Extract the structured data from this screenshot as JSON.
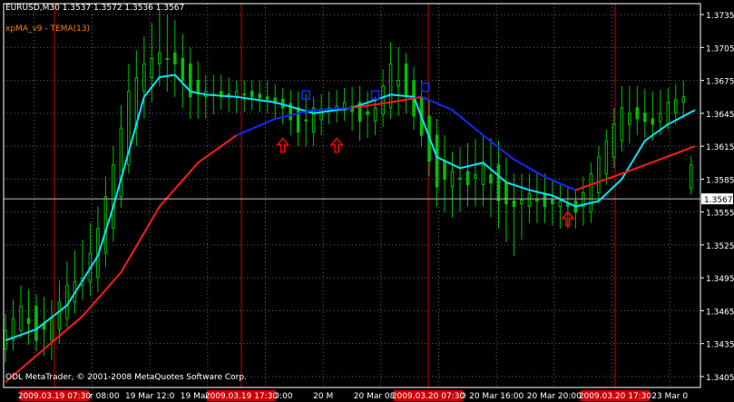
{
  "header": {
    "symbol_line": "EURUSD,M30  1.3537 1.3572 1.3536 1.3567",
    "indicator_line": "xpMA_v9 - TEMA(13)"
  },
  "footer": {
    "copyright": "ODL MetaTrader, © 2001-2008 MetaQuotes Software Corp."
  },
  "colors": {
    "background": "#000000",
    "axis": "#ffffff",
    "grid": "#666666",
    "candle": "#00c000",
    "ema_fast": "#00e5ff",
    "ma_up": "#ff1a1a",
    "ma_down": "#1428ff",
    "vertical_marker": "#cc0000",
    "arrow_up": "#ff0000",
    "arrow_down": "#1428ff"
  },
  "chart_data": {
    "type": "candlestick",
    "symbol": "EURUSD",
    "timeframe": "M30",
    "ohlc_last": {
      "open": 1.3537,
      "high": 1.3572,
      "low": 1.3536,
      "close": 1.3567
    },
    "current_price": 1.3567,
    "current_price_label": "1.3567",
    "ylim": [
      1.3395,
      1.3745
    ],
    "y_ticks": [
      "1.3735",
      "1.3705",
      "1.3675",
      "1.3645",
      "1.3615",
      "1.3585",
      "1.3555",
      "1.3525",
      "1.3495",
      "1.3465",
      "1.3435",
      "1.3405"
    ],
    "x_tick_labels": [
      "19 M",
      "19 Mar 08:00",
      "19 Mar 12:0",
      "19 Mar 20:00",
      "20 Mar 00:00",
      "20 M",
      "20 Mar 08:00",
      "20 Mar 12:00",
      "20 Mar 16:00",
      "20 Mar 20:00",
      "23 Mar 00:00",
      "23 Mar 0"
    ],
    "time_markers": [
      "2009.03.19 07:30",
      "2009.03.19 17:30",
      "2009.03.20 07:30",
      "2009.03.20 17:30"
    ],
    "bars": 180,
    "candles": [
      {
        "i": 0,
        "o": 1.343,
        "h": 1.3462,
        "l": 1.3418,
        "c": 1.3447
      },
      {
        "i": 4,
        "o": 1.3447,
        "h": 1.3488,
        "l": 1.344,
        "c": 1.3469
      },
      {
        "i": 8,
        "o": 1.3469,
        "h": 1.348,
        "l": 1.3428,
        "c": 1.3438
      },
      {
        "i": 12,
        "o": 1.3438,
        "h": 1.3475,
        "l": 1.342,
        "c": 1.3458
      },
      {
        "i": 16,
        "o": 1.3458,
        "h": 1.351,
        "l": 1.345,
        "c": 1.3488
      },
      {
        "i": 20,
        "o": 1.3488,
        "h": 1.353,
        "l": 1.3475,
        "c": 1.3495
      },
      {
        "i": 24,
        "o": 1.3495,
        "h": 1.356,
        "l": 1.3482,
        "c": 1.354
      },
      {
        "i": 28,
        "o": 1.354,
        "h": 1.3615,
        "l": 1.3528,
        "c": 1.3598
      },
      {
        "i": 32,
        "o": 1.3598,
        "h": 1.369,
        "l": 1.359,
        "c": 1.3665
      },
      {
        "i": 36,
        "o": 1.3665,
        "h": 1.3715,
        "l": 1.364,
        "c": 1.369
      },
      {
        "i": 40,
        "o": 1.369,
        "h": 1.374,
        "l": 1.367,
        "c": 1.37
      },
      {
        "i": 44,
        "o": 1.37,
        "h": 1.373,
        "l": 1.366,
        "c": 1.369
      },
      {
        "i": 48,
        "o": 1.369,
        "h": 1.3705,
        "l": 1.364,
        "c": 1.366
      },
      {
        "i": 52,
        "o": 1.366,
        "h": 1.368,
        "l": 1.364,
        "c": 1.3665
      },
      {
        "i": 56,
        "o": 1.3665,
        "h": 1.368,
        "l": 1.3648,
        "c": 1.366
      },
      {
        "i": 60,
        "o": 1.366,
        "h": 1.3675,
        "l": 1.3645,
        "c": 1.3665
      },
      {
        "i": 64,
        "o": 1.3665,
        "h": 1.3675,
        "l": 1.3648,
        "c": 1.366
      },
      {
        "i": 68,
        "o": 1.366,
        "h": 1.3675,
        "l": 1.3645,
        "c": 1.3658
      },
      {
        "i": 72,
        "o": 1.3658,
        "h": 1.3668,
        "l": 1.3635,
        "c": 1.365
      },
      {
        "i": 76,
        "o": 1.365,
        "h": 1.3665,
        "l": 1.3615,
        "c": 1.3628
      },
      {
        "i": 80,
        "o": 1.3628,
        "h": 1.366,
        "l": 1.3615,
        "c": 1.365
      },
      {
        "i": 84,
        "o": 1.365,
        "h": 1.3665,
        "l": 1.3635,
        "c": 1.3648
      },
      {
        "i": 88,
        "o": 1.3648,
        "h": 1.3668,
        "l": 1.3638,
        "c": 1.3655
      },
      {
        "i": 92,
        "o": 1.3655,
        "h": 1.367,
        "l": 1.362,
        "c": 1.3638
      },
      {
        "i": 96,
        "o": 1.3638,
        "h": 1.366,
        "l": 1.3625,
        "c": 1.365
      },
      {
        "i": 100,
        "o": 1.365,
        "h": 1.371,
        "l": 1.364,
        "c": 1.369
      },
      {
        "i": 104,
        "o": 1.369,
        "h": 1.37,
        "l": 1.3645,
        "c": 1.366
      },
      {
        "i": 108,
        "o": 1.366,
        "h": 1.3675,
        "l": 1.3615,
        "c": 1.3625
      },
      {
        "i": 112,
        "o": 1.3625,
        "h": 1.364,
        "l": 1.356,
        "c": 1.3578
      },
      {
        "i": 116,
        "o": 1.3578,
        "h": 1.361,
        "l": 1.355,
        "c": 1.3592
      },
      {
        "i": 120,
        "o": 1.3592,
        "h": 1.3618,
        "l": 1.356,
        "c": 1.358
      },
      {
        "i": 124,
        "o": 1.358,
        "h": 1.3625,
        "l": 1.356,
        "c": 1.3598
      },
      {
        "i": 128,
        "o": 1.3598,
        "h": 1.362,
        "l": 1.354,
        "c": 1.3565
      },
      {
        "i": 132,
        "o": 1.3565,
        "h": 1.359,
        "l": 1.3515,
        "c": 1.356
      },
      {
        "i": 136,
        "o": 1.356,
        "h": 1.359,
        "l": 1.3545,
        "c": 1.3572
      },
      {
        "i": 140,
        "o": 1.3572,
        "h": 1.359,
        "l": 1.3545,
        "c": 1.356
      },
      {
        "i": 144,
        "o": 1.356,
        "h": 1.358,
        "l": 1.354,
        "c": 1.3565
      },
      {
        "i": 148,
        "o": 1.3565,
        "h": 1.3575,
        "l": 1.354,
        "c": 1.3555
      },
      {
        "i": 152,
        "o": 1.3555,
        "h": 1.36,
        "l": 1.3545,
        "c": 1.359
      },
      {
        "i": 156,
        "o": 1.359,
        "h": 1.363,
        "l": 1.358,
        "c": 1.362
      },
      {
        "i": 160,
        "o": 1.362,
        "h": 1.367,
        "l": 1.361,
        "c": 1.365
      },
      {
        "i": 164,
        "o": 1.365,
        "h": 1.367,
        "l": 1.3625,
        "c": 1.364
      },
      {
        "i": 168,
        "o": 1.364,
        "h": 1.3665,
        "l": 1.362,
        "c": 1.3635
      },
      {
        "i": 172,
        "o": 1.3635,
        "h": 1.3668,
        "l": 1.363,
        "c": 1.3655
      },
      {
        "i": 176,
        "o": 1.3655,
        "h": 1.3675,
        "l": 1.364,
        "c": 1.366
      },
      {
        "i": 179,
        "o": 1.3537,
        "h": 1.3572,
        "l": 1.3536,
        "c": 1.3567
      }
    ],
    "series": [
      {
        "name": "TEMA(13)",
        "color": "#00e5ff",
        "x": [
          0,
          8,
          16,
          24,
          28,
          32,
          36,
          40,
          44,
          48,
          52,
          60,
          70,
          80,
          90,
          100,
          106,
          112,
          118,
          124,
          130,
          136,
          142,
          148,
          154,
          160,
          166,
          172,
          179
        ],
        "y": [
          1.3438,
          1.3448,
          1.347,
          1.3515,
          1.356,
          1.361,
          1.366,
          1.3678,
          1.368,
          1.3665,
          1.3662,
          1.366,
          1.3655,
          1.3645,
          1.365,
          1.3662,
          1.366,
          1.3605,
          1.3595,
          1.36,
          1.3582,
          1.3575,
          1.357,
          1.356,
          1.3565,
          1.3585,
          1.362,
          1.3635,
          1.3648
        ]
      },
      {
        "name": "xpMA_v9",
        "x": [
          0,
          10,
          20,
          30,
          40,
          50,
          60,
          70,
          80,
          90,
          100,
          108,
          116,
          124,
          132,
          140,
          148,
          152,
          160,
          170,
          179
        ],
        "y": [
          1.34,
          1.343,
          1.346,
          1.35,
          1.356,
          1.36,
          1.3625,
          1.364,
          1.3648,
          1.365,
          1.3655,
          1.366,
          1.3648,
          1.3625,
          1.3603,
          1.3587,
          1.3575,
          1.358,
          1.359,
          1.3603,
          1.3615
        ],
        "segments": [
          {
            "from": 0,
            "to": 60,
            "color": "#ff1a1a"
          },
          {
            "from": 60,
            "to": 90,
            "color": "#1428ff"
          },
          {
            "from": 90,
            "to": 108,
            "color": "#ff1a1a"
          },
          {
            "from": 108,
            "to": 148,
            "color": "#1428ff"
          },
          {
            "from": 148,
            "to": 179,
            "color": "#ff1a1a"
          }
        ]
      }
    ],
    "arrows": [
      {
        "type": "up",
        "x": 72,
        "y": 1.3622
      },
      {
        "type": "down",
        "x": 78,
        "y": 1.3658
      },
      {
        "type": "up",
        "x": 86,
        "y": 1.3622
      },
      {
        "type": "down",
        "x": 96,
        "y": 1.3658
      },
      {
        "type": "down",
        "x": 109,
        "y": 1.3665
      },
      {
        "type": "up",
        "x": 146,
        "y": 1.3555
      }
    ]
  }
}
